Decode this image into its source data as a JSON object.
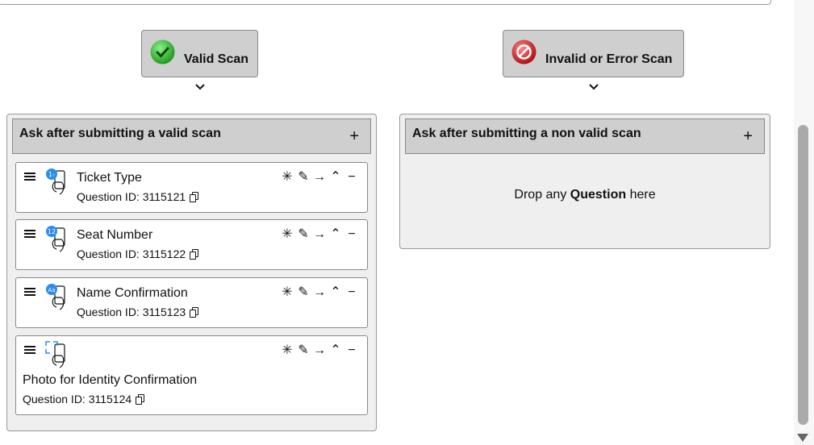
{
  "scan_buttons": {
    "valid": {
      "label": "Valid Scan",
      "color": "#2eb82e"
    },
    "invalid": {
      "label": "Invalid or Error Scan",
      "color": "#d21f1f"
    }
  },
  "valid_column": {
    "title": "Ask after submitting a valid scan",
    "add_symbol": "+",
    "questions": [
      {
        "title": "Ticket Type",
        "id_text": "Question ID: 3115121",
        "icon": "list-choice-icon",
        "badge": "1-"
      },
      {
        "title": "Seat Number",
        "id_text": "Question ID: 3115122",
        "icon": "number-input-icon",
        "badge": "12"
      },
      {
        "title": "Name Confirmation",
        "id_text": "Question ID: 3115123",
        "icon": "text-input-icon",
        "badge": "Aa"
      },
      {
        "title": "Photo for Identity Confirmation",
        "id_text": "Question ID: 3115124",
        "icon": "photo-capture-icon",
        "badge": ""
      }
    ]
  },
  "invalid_column": {
    "title": "Ask after submitting a non valid scan",
    "add_symbol": "+",
    "drop_prefix": "Drop any ",
    "drop_bold": "Question",
    "drop_suffix": " here"
  },
  "actions": {
    "required": "✳",
    "edit": "✎",
    "branch": "→",
    "collapse": "⌃",
    "remove": "−"
  }
}
